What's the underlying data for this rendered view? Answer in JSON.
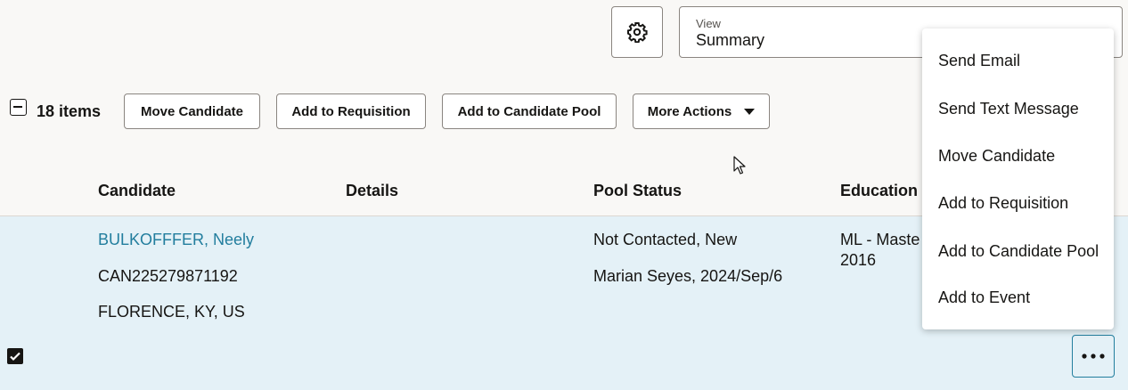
{
  "header": {
    "view_label": "View",
    "view_value": "Summary"
  },
  "toolbar": {
    "items_count": "18 items",
    "move_candidate": "Move Candidate",
    "add_to_requisition": "Add to Requisition",
    "add_to_candidate_pool": "Add to Candidate Pool",
    "more_actions": "More Actions"
  },
  "table": {
    "columns": [
      "Candidate",
      "Details",
      "Pool Status",
      "Education"
    ],
    "rows": [
      {
        "name": "BULKOFFFER, Neely",
        "id": "CAN225279871192",
        "location": "FLORENCE, KY, US",
        "pool_status": "Not Contacted, New",
        "pool_added": "Marian Seyes, 2024/Sep/6",
        "education_line1": "ML - Maste",
        "education_line2": "2016"
      }
    ]
  },
  "menu": {
    "items": [
      "Send Email",
      "Send Text Message",
      "Move Candidate",
      "Add to Requisition",
      "Add to Candidate Pool",
      "Add to Event"
    ]
  },
  "colors": {
    "link": "#227e9e",
    "selected_row": "#e4f1f7",
    "page_bg": "#f9f8f6"
  }
}
